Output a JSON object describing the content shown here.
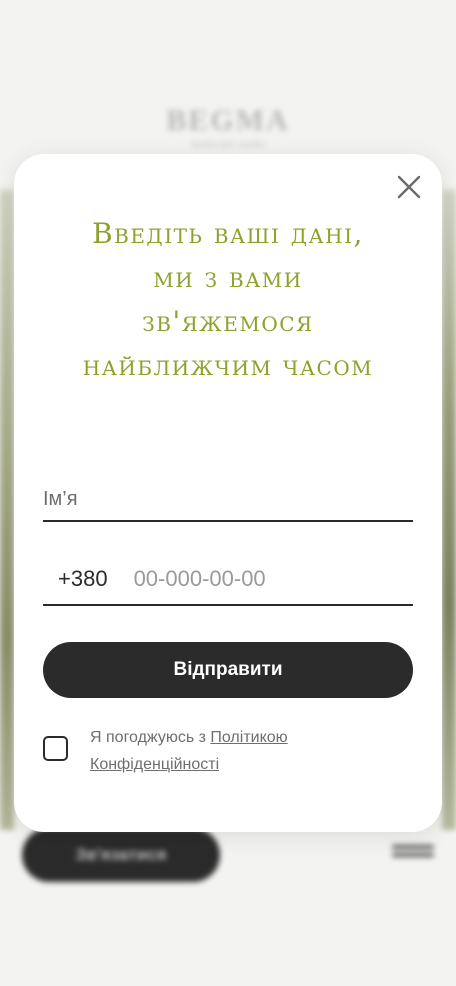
{
  "background": {
    "logo": "BEGMA",
    "tagline": "landscape studio",
    "contact_button": "Зв'язатися"
  },
  "modal": {
    "title_lines": [
      "Введіть ваші дані,",
      "ми з вами",
      "зв'яжемося",
      "найближчим часом"
    ],
    "name_placeholder": "Ім’я",
    "phone": {
      "flag": "ukraine-flag-icon",
      "country_code": "+380",
      "placeholder": "00-000-00-00"
    },
    "submit_label": "Відправити",
    "consent": {
      "checked": false,
      "text_prefix": "Я погоджуюсь з ",
      "link_line1": "Політикою",
      "link_line2": "Конфіденційності"
    }
  },
  "colors": {
    "accent": "#8fa12a",
    "dark": "#2b2b2b",
    "flag_blue": "#1f5fd0",
    "flag_yellow": "#f7d100"
  }
}
